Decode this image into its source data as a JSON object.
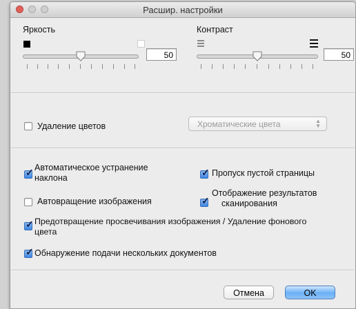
{
  "window": {
    "title": "Расшир. настройки"
  },
  "brightness": {
    "label": "Яркость",
    "value": "50"
  },
  "contrast": {
    "label": "Контраст",
    "value": "50"
  },
  "color_removal": {
    "label": "Удаление цветов",
    "checked": false,
    "dropdown_value": "Хроматические цвета"
  },
  "options": {
    "auto_deskew": {
      "label_line1": "Автоматическое устранение",
      "label_line2": "наклона",
      "checked": true
    },
    "skip_blank_page": {
      "label": "Пропуск пустой страницы",
      "checked": true
    },
    "auto_rotate": {
      "label": "Автовращение изображения",
      "checked": false
    },
    "show_scan_results": {
      "label_line1": "Отображение результатов",
      "label_line2": "сканирования",
      "checked": true
    },
    "bleed_through": {
      "label_line1": "Предотвращение просвечивания изображения / Удаление фонового",
      "label_line2": "цвета",
      "checked": true
    },
    "multifeed_detect": {
      "label": "Обнаружение подачи нескольких документов",
      "checked": true
    }
  },
  "buttons": {
    "cancel": "Отмена",
    "ok": "OK"
  },
  "colors": {
    "accent": "#4a90e2",
    "close_button": "#e0605a"
  }
}
